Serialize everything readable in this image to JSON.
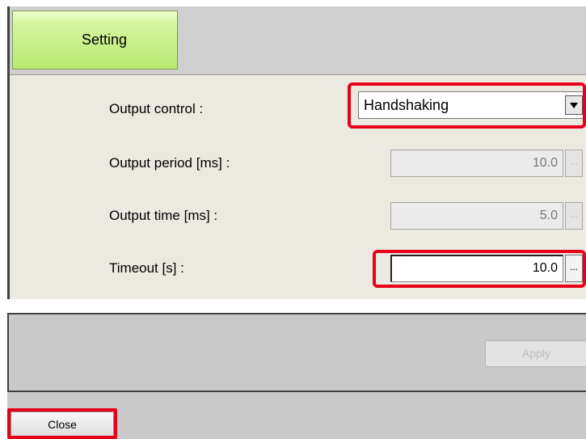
{
  "tabs": [
    {
      "label": "Setting",
      "active": true
    }
  ],
  "form": {
    "output_control": {
      "label": "Output control :",
      "value": "Handshaking",
      "enabled": true
    },
    "output_period": {
      "label": "Output period [ms] :",
      "value": "10.0",
      "enabled": false,
      "button_label": "..."
    },
    "output_time": {
      "label": "Output time [ms] :",
      "value": "5.0",
      "enabled": false,
      "button_label": "..."
    },
    "timeout": {
      "label": "Timeout [s] :",
      "value": "10.0",
      "enabled": true,
      "button_label": "..."
    }
  },
  "footer": {
    "apply_label": "Apply",
    "apply_enabled": false,
    "close_label": "Close"
  },
  "colors": {
    "highlight": "#e8001b",
    "tab_active": "#b8ea72",
    "panel_bg": "#ece9e1",
    "footer_bg": "#c9c9c9"
  },
  "icons": {
    "select_arrow": "chevron-down-icon",
    "ellipsis": "ellipsis-icon"
  }
}
